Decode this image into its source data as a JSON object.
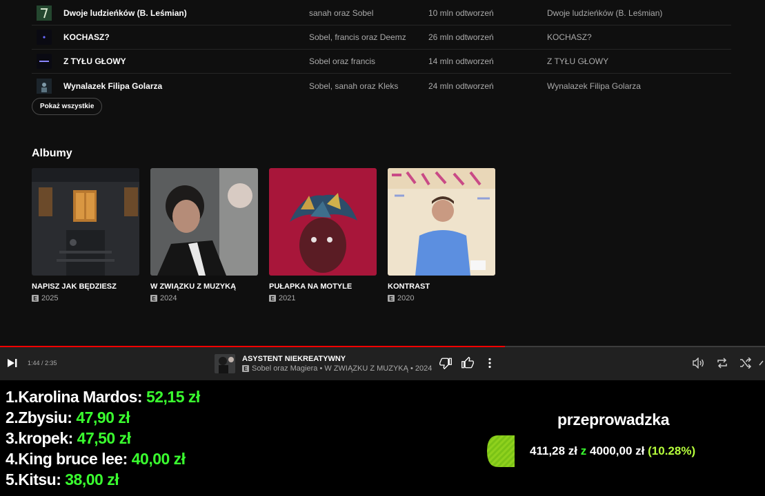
{
  "songs": [
    {
      "title": "Dwoje ludzieńków (B. Leśmian)",
      "artist": "sanah oraz Sobel",
      "plays": "10 mln odtworzeń",
      "album": "Dwoje ludzieńków (B. Leśmian)"
    },
    {
      "title": "KOCHASZ?",
      "artist": "Sobel, francis oraz Deemz",
      "plays": "26 mln odtworzeń",
      "album": "KOCHASZ?"
    },
    {
      "title": "Z TYŁU GŁOWY",
      "artist": "Sobel oraz francis",
      "plays": "14 mln odtworzeń",
      "album": "Z TYŁU GŁOWY"
    },
    {
      "title": "Wynalazek Filipa Golarza",
      "artist": "Sobel, sanah oraz Kleks",
      "plays": "24 mln odtworzeń",
      "album": "Wynalazek Filipa Golarza"
    }
  ],
  "show_all_label": "Pokaż wszystkie",
  "albums_heading": "Albumy",
  "albums": [
    {
      "title": "NAPISZ JAK BĘDZIESZ",
      "badge": "E",
      "year": "2025"
    },
    {
      "title": "W ZWIĄZKU Z MUZYKĄ",
      "badge": "E",
      "year": "2024"
    },
    {
      "title": "PUŁAPKA NA MOTYLE",
      "badge": "E",
      "year": "2021"
    },
    {
      "title": "KONTRAST",
      "badge": "E",
      "year": "2020"
    }
  ],
  "player": {
    "time": "1:44 / 2:35",
    "progress": 0.66,
    "title": "ASYSTENT NIEKREATYWNY",
    "badge": "E",
    "meta": "Sobel oraz Magiera • W ZWIĄZKU Z MUZYKĄ • 2024",
    "icons": [
      "play-next-icon",
      "dislike-icon",
      "like-icon",
      "more-icon",
      "volume-icon",
      "repeat-icon",
      "shuffle-icon"
    ]
  },
  "leaderboard": [
    {
      "rank": "1.",
      "name": "Karolina Mardos:",
      "amount": "52,15 zł"
    },
    {
      "rank": "2.",
      "name": "Zbysiu:",
      "amount": "47,90 zł"
    },
    {
      "rank": "3.",
      "name": "kropek:",
      "amount": "47,50 zł"
    },
    {
      "rank": "4.",
      "name": "King bruce lee:",
      "amount": "40,00 zł"
    },
    {
      "rank": "5.",
      "name": "Kitsu:",
      "amount": "38,00 zł"
    }
  ],
  "goal": {
    "title": "przeprowadzka",
    "current": "411,28 zł",
    "sep": "z",
    "target": "4000,00 zł",
    "percent": "(10.28%)",
    "fraction": 0.1028
  },
  "colors": {
    "accent_green": "#3aff2f",
    "progress_red": "#ff0000",
    "percent_lime": "#b7ff3c"
  }
}
